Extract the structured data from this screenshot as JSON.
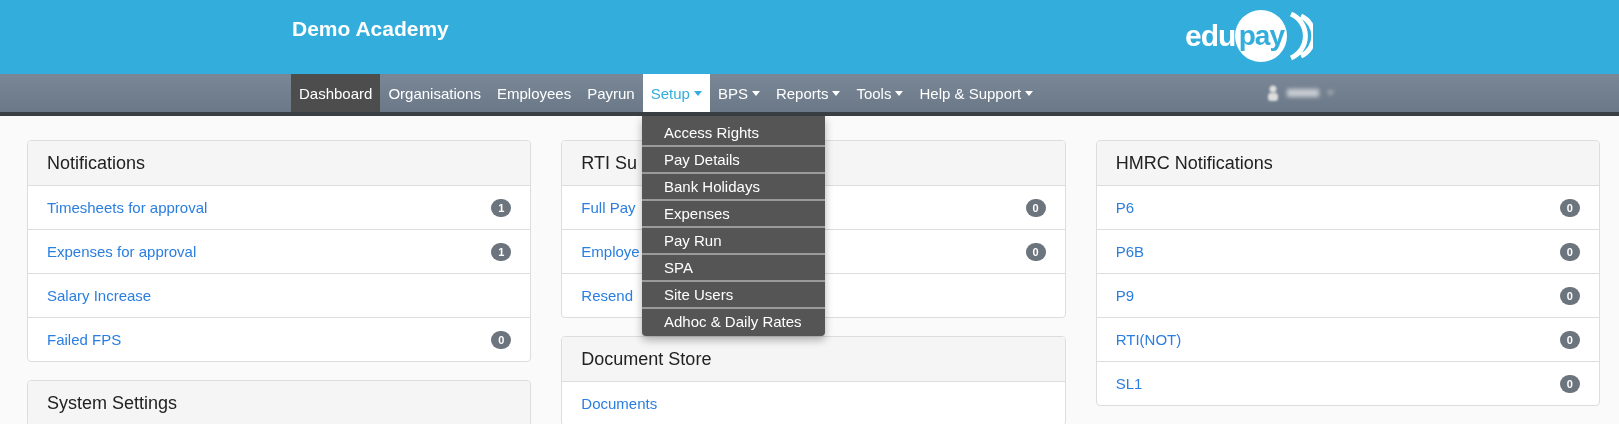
{
  "header": {
    "title": "Demo Academy",
    "logo": {
      "part_1": "edu",
      "part_2": "pay"
    }
  },
  "nav": {
    "items": [
      {
        "label": "Dashboard",
        "selected": true,
        "open": false,
        "dropdown": false
      },
      {
        "label": "Organisations",
        "selected": false,
        "open": false,
        "dropdown": false
      },
      {
        "label": "Employees",
        "selected": false,
        "open": false,
        "dropdown": false
      },
      {
        "label": "Payrun",
        "selected": false,
        "open": false,
        "dropdown": false
      },
      {
        "label": "Setup",
        "selected": false,
        "open": true,
        "dropdown": true
      },
      {
        "label": "BPS",
        "selected": false,
        "open": false,
        "dropdown": true
      },
      {
        "label": "Reports",
        "selected": false,
        "open": false,
        "dropdown": true
      },
      {
        "label": "Tools",
        "selected": false,
        "open": false,
        "dropdown": true
      },
      {
        "label": "Help & Support",
        "selected": false,
        "open": false,
        "dropdown": true
      }
    ],
    "user_menu": {
      "redacted": true
    }
  },
  "setup_menu": [
    "Access Rights",
    "Pay Details",
    "Bank Holidays",
    "Expenses",
    "Pay Run",
    "SPA",
    "Site Users",
    "Adhoc & Daily Rates"
  ],
  "columns": [
    [
      {
        "title": "Notifications",
        "items": [
          {
            "label": "Timesheets for approval",
            "count": "1"
          },
          {
            "label": "Expenses for approval",
            "count": "1"
          },
          {
            "label": "Salary Increase"
          },
          {
            "label": "Failed FPS",
            "count": "0"
          }
        ]
      },
      {
        "title": "System Settings"
      }
    ],
    [
      {
        "title": "RTI Su",
        "items": [
          {
            "label": "Full Pay",
            "count": "0"
          },
          {
            "label": "Employe",
            "count": "0"
          },
          {
            "label": "Resend"
          }
        ]
      },
      {
        "title": "Document Store",
        "items": [
          {
            "label": "Documents"
          }
        ]
      }
    ],
    [
      {
        "title": "HMRC Notifications",
        "items": [
          {
            "label": "P6",
            "count": "0"
          },
          {
            "label": "P6B",
            "count": "0"
          },
          {
            "label": "P9",
            "count": "0"
          },
          {
            "label": "RTI(NOT)",
            "count": "0"
          },
          {
            "label": "SL1",
            "count": "0"
          }
        ]
      }
    ]
  ]
}
